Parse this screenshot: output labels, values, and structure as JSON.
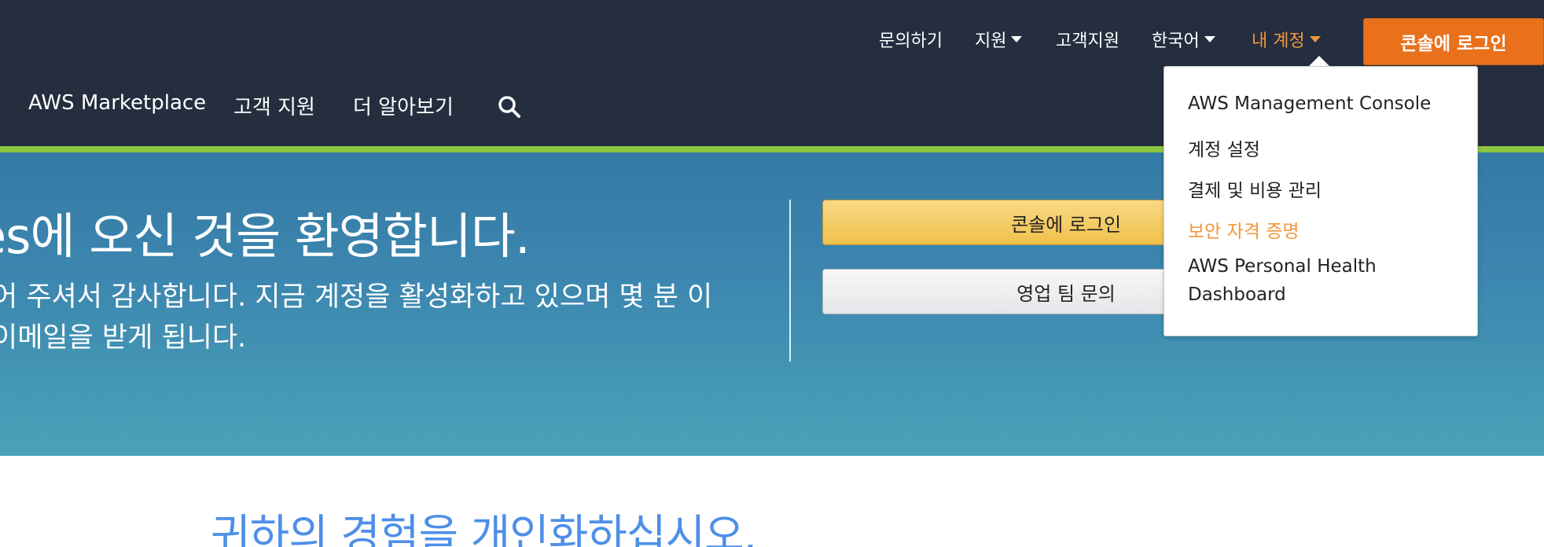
{
  "colors": {
    "header_bg": "#242e3e",
    "accent_green": "#8dc63f",
    "accent_orange": "#f0973b",
    "console_button": "#e9711c",
    "link_blue": "#4e8fe8"
  },
  "util_nav": {
    "contact": "문의하기",
    "support": "지원",
    "customer_support": "고객지원",
    "language": "한국어",
    "my_account": "내 계정",
    "console_login": "콘솔에 로그인"
  },
  "main_nav": {
    "marketplace": "AWS Marketplace",
    "customer_support": "고객 지원",
    "learn_more": "더 알아보기",
    "search_icon": "search-icon"
  },
  "hero": {
    "title": "es에 오신 것을 환영합니다.",
    "line1": "어 주셔서 감사합니다. 지금 계정을 활성화하고 있으며 몇 분 이",
    "line2": "이메일을 받게 됩니다.",
    "console_button": "콘솔에 로그인",
    "sales_button": "영업 팀 문의"
  },
  "account_menu": {
    "items": [
      "AWS Management Console",
      "계정 설정",
      "결제 및 비용 관리",
      "보안 자격 증명",
      "AWS Personal Health Dashboard"
    ]
  },
  "bottom": {
    "title": "귀하의 경험을 개인화하십시오."
  }
}
